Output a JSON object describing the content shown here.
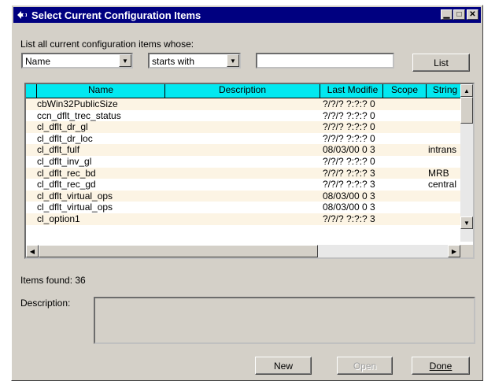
{
  "window": {
    "title": "Select Current Configuration Items",
    "controls": {
      "minimize": "▁",
      "maximize": "□",
      "close": "✕"
    }
  },
  "filter": {
    "prompt": "List all current configuration items whose:",
    "field": "Name",
    "operator": "starts with",
    "value": "",
    "list_button": "List"
  },
  "table": {
    "columns": [
      "Name",
      "Description",
      "Last Modifie",
      "Scope",
      "String"
    ],
    "rows": [
      {
        "name": "cbWin32PublicSize",
        "description": "",
        "last_modified": "?/?/? ?:?:? 0",
        "scope": "",
        "string": ""
      },
      {
        "name": "ccn_dflt_trec_status",
        "description": "",
        "last_modified": "?/?/? ?:?:? 0",
        "scope": "",
        "string": ""
      },
      {
        "name": "cl_dflt_dr_gl",
        "description": "",
        "last_modified": "?/?/? ?:?:? 0",
        "scope": "",
        "string": ""
      },
      {
        "name": "cl_dflt_dr_loc",
        "description": "",
        "last_modified": "?/?/? ?:?:? 0",
        "scope": "",
        "string": ""
      },
      {
        "name": "cl_dflt_fulf",
        "description": "",
        "last_modified": "08/03/00 0 3",
        "scope": "",
        "string": "intrans"
      },
      {
        "name": "cl_dflt_inv_gl",
        "description": "",
        "last_modified": "?/?/? ?:?:? 0",
        "scope": "",
        "string": ""
      },
      {
        "name": "cl_dflt_rec_bd",
        "description": "",
        "last_modified": "?/?/? ?:?:? 3",
        "scope": "",
        "string": "MRB"
      },
      {
        "name": "cl_dflt_rec_gd",
        "description": "",
        "last_modified": "?/?/? ?:?:? 3",
        "scope": "",
        "string": "central"
      },
      {
        "name": "cl_dflt_virtual_ops",
        "description": "",
        "last_modified": "08/03/00 0 3",
        "scope": "",
        "string": ""
      },
      {
        "name": "cl_dflt_virtual_ops",
        "description": "",
        "last_modified": "08/03/00 0 3",
        "scope": "",
        "string": ""
      },
      {
        "name": "cl_option1",
        "description": "",
        "last_modified": "?/?/? ?:?:? 3",
        "scope": "",
        "string": ""
      }
    ]
  },
  "items_found": "Items found: 36",
  "description": {
    "label": "Description:",
    "value": ""
  },
  "buttons": {
    "new": "New",
    "open": "Open",
    "done": "Done"
  }
}
